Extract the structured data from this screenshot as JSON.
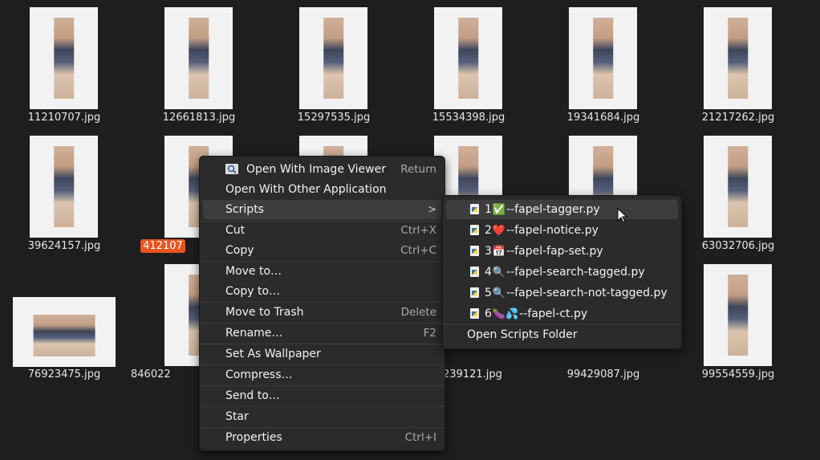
{
  "files": [
    {
      "name": "11210707.jpg"
    },
    {
      "name": "12661813.jpg"
    },
    {
      "name": "15297535.jpg"
    },
    {
      "name": "15534398.jpg"
    },
    {
      "name": "19341684.jpg"
    },
    {
      "name": "21217262.jpg"
    },
    {
      "name": "39624157.jpg"
    },
    {
      "name": "412107",
      "selected": true
    },
    {
      "name": "63032706.jpg"
    },
    {
      "name": "76923475.jpg"
    },
    {
      "name": "846022"
    },
    {
      "name": "239121.jpg"
    },
    {
      "name": "99429087.jpg"
    },
    {
      "name": "99554559.jpg"
    }
  ],
  "menu": {
    "open_with_viewer": "Open With Image Viewer",
    "open_with_viewer_accel": "Return",
    "open_with_other": "Open With Other Application",
    "scripts": "Scripts",
    "scripts_arrow": ">",
    "cut": "Cut",
    "cut_accel": "Ctrl+X",
    "copy": "Copy",
    "copy_accel": "Ctrl+C",
    "move_to": "Move to…",
    "copy_to": "Copy to…",
    "move_to_trash": "Move to Trash",
    "move_to_trash_accel": "Delete",
    "rename": "Rename…",
    "rename_accel": "F2",
    "set_as_wallpaper": "Set As Wallpaper",
    "compress": "Compress…",
    "send_to": "Send to…",
    "star": "Star",
    "properties": "Properties",
    "properties_accel": "Ctrl+I"
  },
  "scripts_submenu": {
    "items": [
      {
        "prefix": "1",
        "emoji": "✅",
        "name": "--fapel-tagger.py"
      },
      {
        "prefix": "2",
        "emoji": "❤️",
        "name": "--fapel-notice.py"
      },
      {
        "prefix": "3",
        "emoji": "📅",
        "name": "--fapel-fap-set.py"
      },
      {
        "prefix": "4",
        "emoji": "🔍",
        "name": "--fapel-search-tagged.py"
      },
      {
        "prefix": "5",
        "emoji": "🔍",
        "name": "--fapel-search-not-tagged.py"
      },
      {
        "prefix": "6",
        "emoji": "🍆💦",
        "name": "--fapel-ct.py"
      }
    ],
    "open_folder": "Open Scripts Folder"
  },
  "colors": {
    "selection_accent": "#e95420",
    "menu_bg": "#2b2b2b",
    "background": "#1e1e1e"
  },
  "icons": {
    "image-viewer": "magnifier-icon",
    "python-file": "python-file-icon",
    "pointer": "arrow-cursor-icon"
  }
}
